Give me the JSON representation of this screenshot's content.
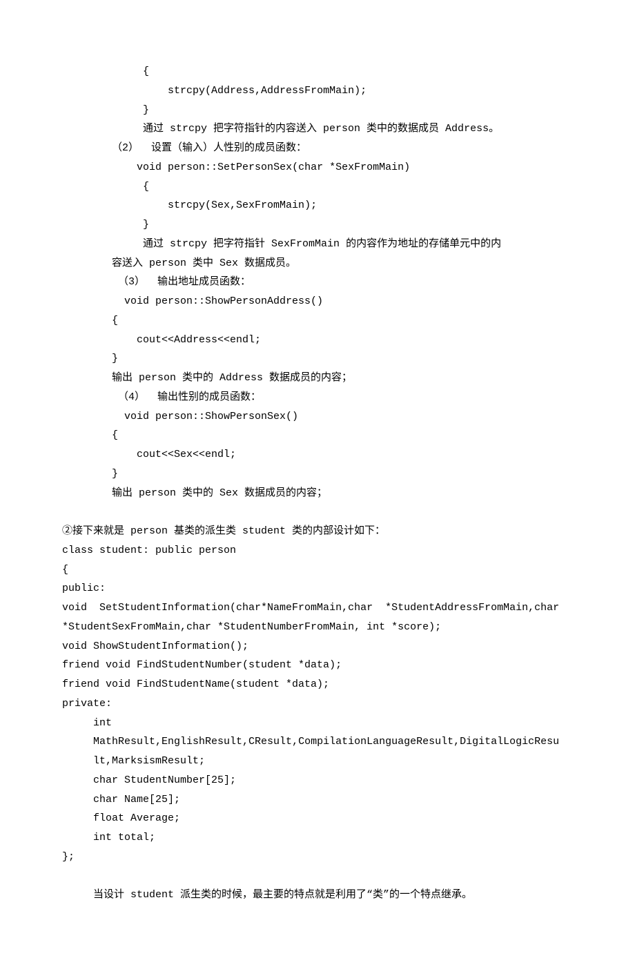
{
  "lines": [
    "             {",
    "                 strcpy(Address,AddressFromMain);",
    "             }",
    "             通过 strcpy 把字符指针的内容送入 person 类中的数据成员 Address。",
    "        （2）  设置（输入）人性别的成员函数：",
    "            void person::SetPersonSex(char *SexFromMain)",
    "             {",
    "                 strcpy(Sex,SexFromMain);",
    "             }",
    "             通过 strcpy 把字符指针 SexFromMain 的内容作为地址的存储单元中的内",
    "        容送入 person 类中 Sex 数据成员。",
    "         （3）  输出地址成员函数：",
    "          void person::ShowPersonAddress()",
    "        {",
    "            cout<<Address<<endl;",
    "        }",
    "        输出 person 类中的 Address 数据成员的内容；",
    "         （4）  输出性别的成员函数：",
    "          void person::ShowPersonSex()",
    "        {",
    "            cout<<Sex<<endl;",
    "        }",
    "        输出 person 类中的 Sex 数据成员的内容；",
    "",
    "②接下来就是 person 基类的派生类 student 类的内部设计如下：",
    "class student: public person",
    "{",
    "public:",
    "void  SetStudentInformation(char*NameFromMain,char  *StudentAddressFromMain,char",
    "*StudentSexFromMain,char *StudentNumberFromMain, int *score);",
    "void ShowStudentInformation();",
    "friend void FindStudentNumber(student *data);",
    "friend void FindStudentName(student *data);",
    "private:",
    "     int",
    "     MathResult,EnglishResult,CResult,CompilationLanguageResult,DigitalLogicResu",
    "     lt,MarksismResult;",
    "     char StudentNumber[25];",
    "     char Name[25];",
    "     float Average;",
    "     int total;",
    "};",
    "",
    "     当设计 student 派生类的时候，最主要的特点就是利用了“类”的一个特点继承。"
  ]
}
